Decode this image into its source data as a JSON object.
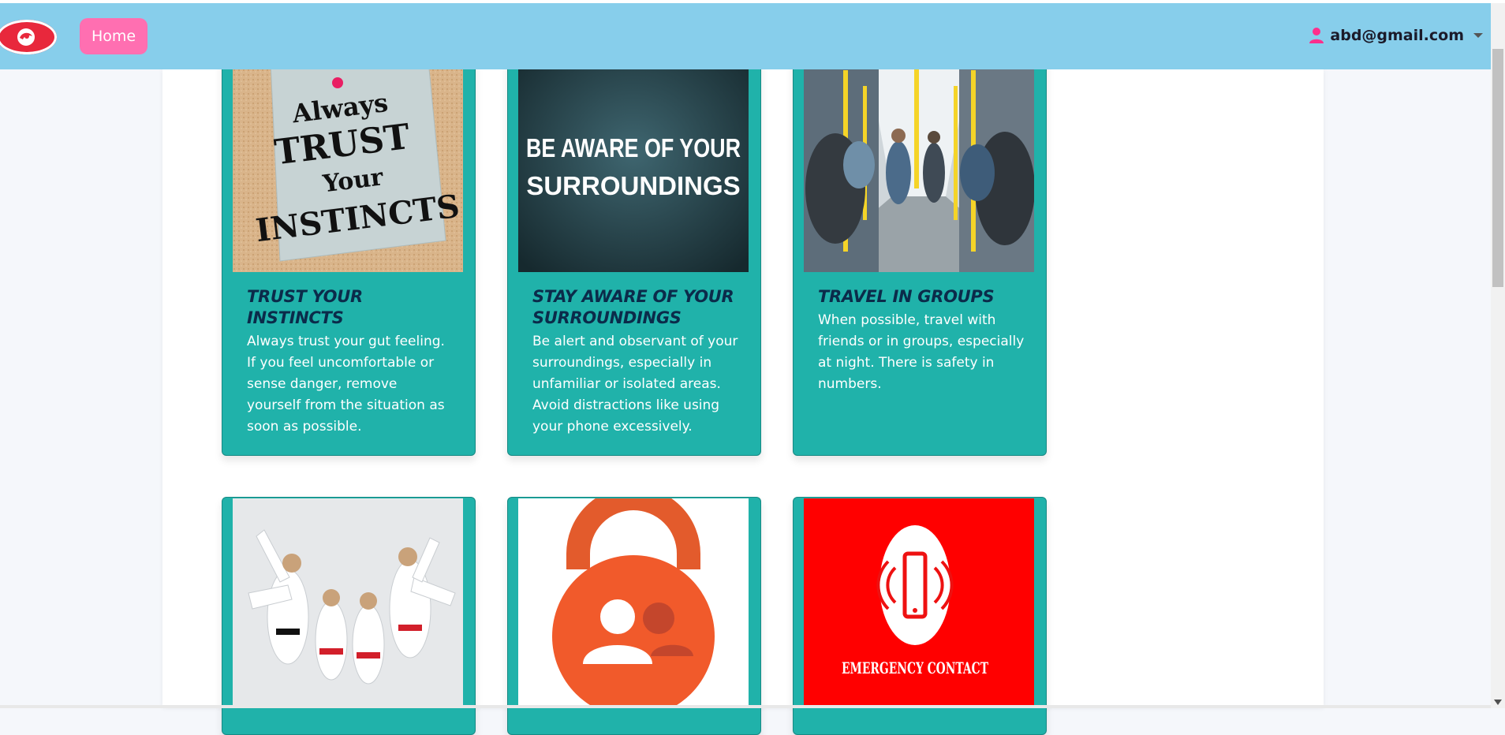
{
  "navbar": {
    "home_label": "Home",
    "user_email": "abd@gmail.com",
    "colors": {
      "background": "#87ceeb",
      "home_button": "#ff6fb1",
      "logo": "#e8283c",
      "user_icon": "#ff2f8c"
    }
  },
  "cards": [
    {
      "title": "TRUST YOUR INSTINCTS",
      "description": "Always trust your gut feeling. If you feel uncomfortable or sense danger, remove yourself from the situation as soon as possible.",
      "image_text": [
        "Always",
        "TRUST",
        "Your",
        "INSTINCTS"
      ]
    },
    {
      "title": "STAY AWARE OF YOUR SURROUNDINGS",
      "description": "Be alert and observant of your surroundings, especially in unfamiliar or isolated areas. Avoid distractions like using your phone excessively.",
      "image_text": [
        "BE AWARE OF YOUR",
        "SURROUNDINGS"
      ]
    },
    {
      "title": "TRAVEL IN GROUPS",
      "description": "When possible, travel with friends or in groups, especially at night. There is safety in numbers.",
      "image_text": []
    },
    {
      "title": "",
      "description": "",
      "image_text": []
    },
    {
      "title": "",
      "description": "",
      "image_text": []
    },
    {
      "title": "",
      "description": "",
      "image_text": [
        "EMERGENCY CONTACT"
      ]
    }
  ],
  "colors": {
    "card": "#20b2aa",
    "card_title": "#0b2b4a",
    "card_text": "#ffffff"
  }
}
